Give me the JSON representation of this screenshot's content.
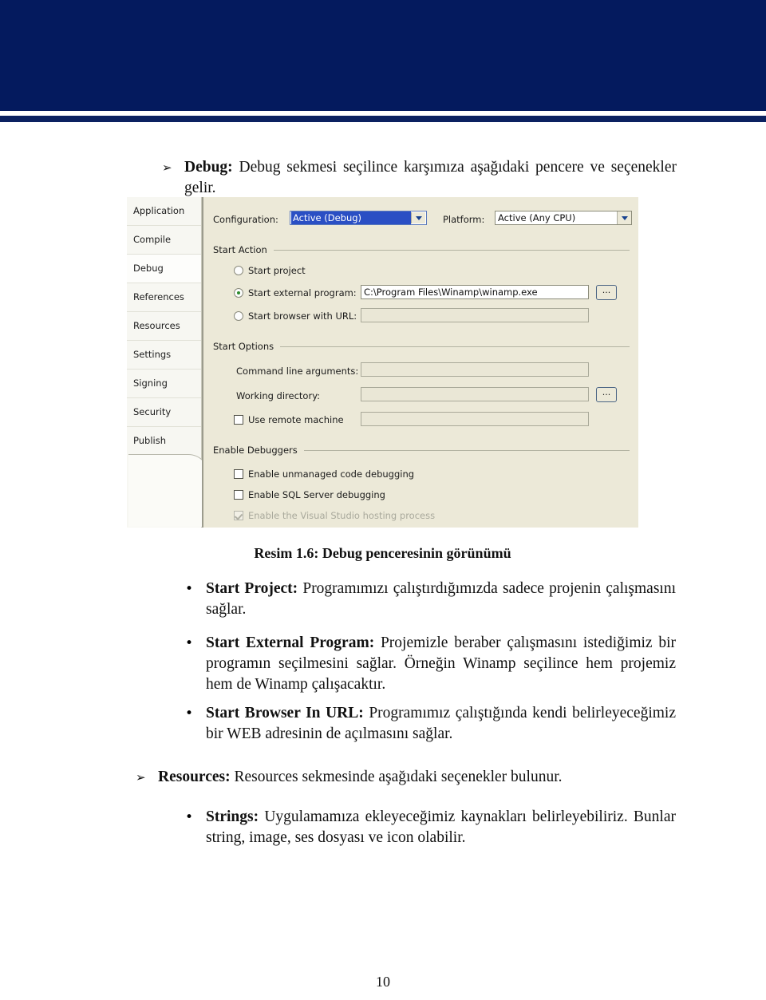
{
  "header": {
    "banner_color": "#041a5e",
    "rule_color": "#0b2161"
  },
  "content": {
    "intro": {
      "marker": "➢",
      "lead": "Debug:",
      "text": " Debug sekmesi seçilince karşımıza aşağıdaki pencere ve seçenekler gelir."
    },
    "caption": "Resim 1.6: Debug penceresinin görünümü",
    "items": [
      {
        "marker": "•",
        "lead": "Start Project:",
        "text": " Programımızı çalıştırdığımızda sadece projenin çalışmasını sağlar."
      },
      {
        "marker": "•",
        "lead": "Start External Program:",
        "text": " Projemizle beraber çalışmasını istediğimiz bir programın seçilmesini sağlar. Örneğin Winamp seçilince hem projemiz hem de Winamp çalışacaktır."
      },
      {
        "marker": "•",
        "lead": "Start Browser In URL:",
        "text": " Programımız çalıştığında kendi belirleyeceğimiz bir WEB adresinin de açılmasını sağlar."
      },
      {
        "marker": "➢",
        "lead": "Resources:",
        "text": " Resources sekmesinde aşağıdaki seçenekler bulunur."
      },
      {
        "marker": "•",
        "lead": "Strings:",
        "text": " Uygulamamıza ekleyeceğimiz kaynakları belirleyebiliriz. Bunlar string, image, ses dosyası ve icon olabilir."
      }
    ],
    "page_number": "10"
  },
  "dialog": {
    "tabs": [
      {
        "label": "Application",
        "selected": false
      },
      {
        "label": "Compile",
        "selected": false
      },
      {
        "label": "Debug",
        "selected": true
      },
      {
        "label": "References",
        "selected": false
      },
      {
        "label": "Resources",
        "selected": false
      },
      {
        "label": "Settings",
        "selected": false
      },
      {
        "label": "Signing",
        "selected": false
      },
      {
        "label": "Security",
        "selected": false
      },
      {
        "label": "Publish",
        "selected": false
      }
    ],
    "configuration": {
      "label": "Configuration:",
      "value": "Active (Debug)",
      "highlighted": true
    },
    "platform": {
      "label": "Platform:",
      "value": "Active (Any CPU)",
      "highlighted": false
    },
    "start_action": {
      "group_label": "Start Action",
      "options": [
        {
          "label": "Start project",
          "selected": false
        },
        {
          "label": "Start external program:",
          "selected": true
        },
        {
          "label": "Start browser with URL:",
          "selected": false
        }
      ],
      "external_program_value": "C:\\Program Files\\Winamp\\winamp.exe",
      "browser_url_value": "",
      "browse_label": "..."
    },
    "start_options": {
      "group_label": "Start Options",
      "command_line_label": "Command line arguments:",
      "command_line_value": "",
      "working_dir_label": "Working directory:",
      "working_dir_value": "",
      "remote_machine_label": "Use remote machine",
      "remote_machine_checked": false,
      "remote_machine_value": "",
      "browse_label": "..."
    },
    "enable_debuggers": {
      "group_label": "Enable Debuggers",
      "checks": [
        {
          "label": "Enable unmanaged code debugging",
          "checked": false,
          "disabled": false
        },
        {
          "label": "Enable SQL Server debugging",
          "checked": false,
          "disabled": false
        },
        {
          "label": "Enable the Visual Studio hosting process",
          "checked": true,
          "disabled": true
        }
      ]
    }
  }
}
